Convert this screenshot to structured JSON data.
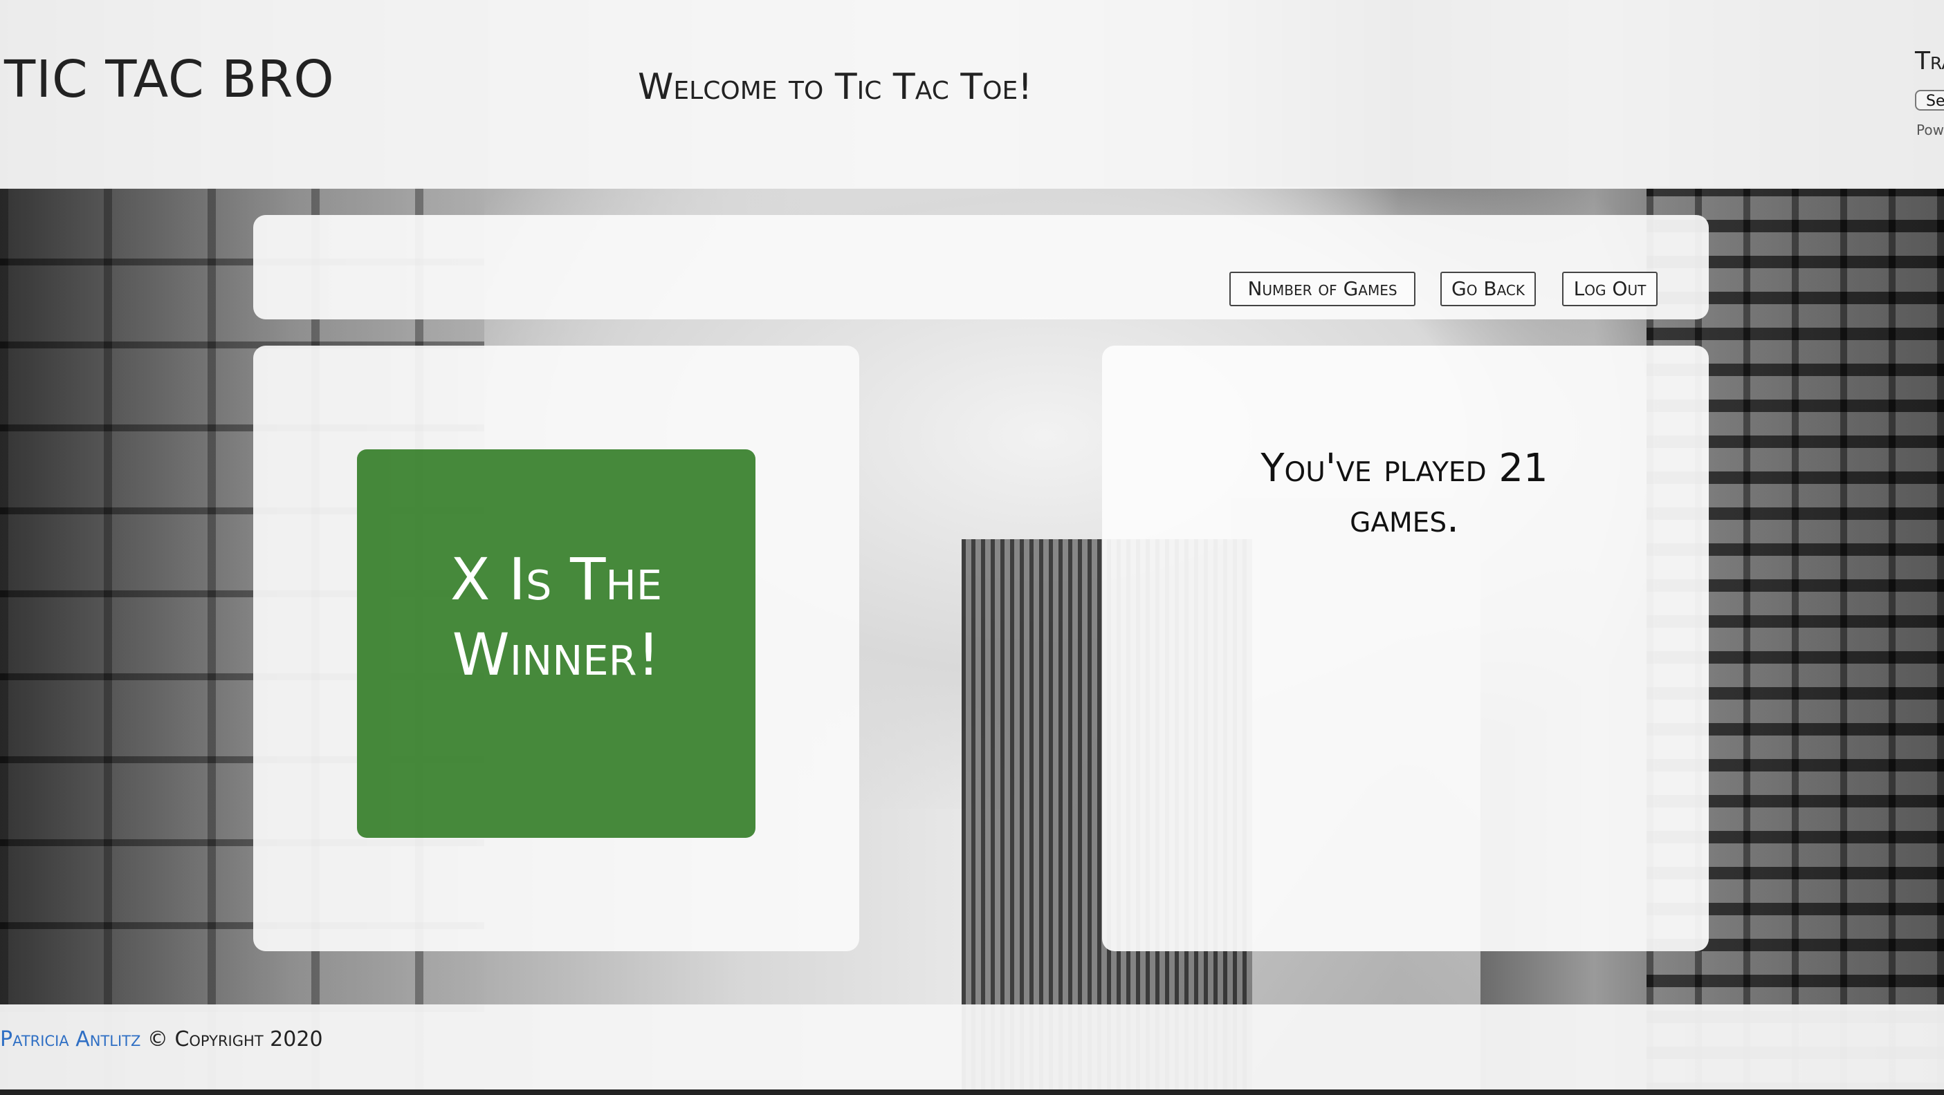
{
  "header": {
    "brand": "TIC TAC BRO",
    "welcome": "Welcome to Tic Tac Toe!",
    "translate": {
      "label": "Tra",
      "select_value": "Se",
      "powered_by": "Pow"
    }
  },
  "nav": {
    "buttons": [
      {
        "label": "Number of Games"
      },
      {
        "label": "Go Back"
      },
      {
        "label": "Log Out"
      }
    ]
  },
  "game": {
    "result_line1": "X Is The",
    "result_line2": "Winner!",
    "result_color": "#3f8a36"
  },
  "stats": {
    "games_played_text": "You've played 21 games."
  },
  "footer": {
    "author": "Patricia Antlitz",
    "copyright": "© Copyright 2020",
    "link_color": "#2f6fc4"
  }
}
